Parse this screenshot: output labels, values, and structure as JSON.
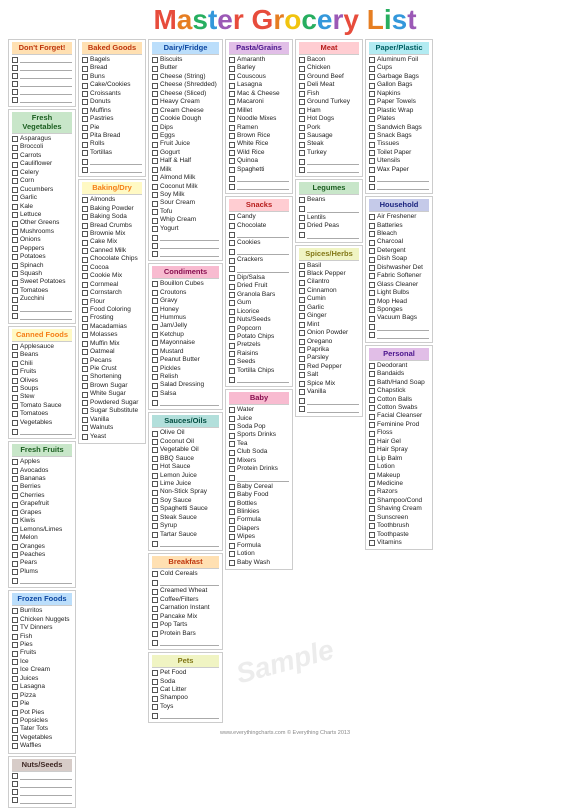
{
  "title": {
    "text": "Master Grocery List",
    "letters": [
      {
        "char": "M",
        "color": "#e74c3c"
      },
      {
        "char": "a",
        "color": "#e67e22"
      },
      {
        "char": "s",
        "color": "#27ae60"
      },
      {
        "char": "t",
        "color": "#3498db"
      },
      {
        "char": "e",
        "color": "#9b59b6"
      },
      {
        "char": "r",
        "color": "#e74c3c"
      },
      {
        "char": " ",
        "color": "#000"
      },
      {
        "char": "G",
        "color": "#e74c3c"
      },
      {
        "char": "r",
        "color": "#e67e22"
      },
      {
        "char": "o",
        "color": "#f1c40f"
      },
      {
        "char": "c",
        "color": "#27ae60"
      },
      {
        "char": "e",
        "color": "#3498db"
      },
      {
        "char": "r",
        "color": "#9b59b6"
      },
      {
        "char": "y",
        "color": "#e74c3c"
      },
      {
        "char": " ",
        "color": "#000"
      },
      {
        "char": "L",
        "color": "#e67e22"
      },
      {
        "char": "i",
        "color": "#27ae60"
      },
      {
        "char": "s",
        "color": "#3498db"
      },
      {
        "char": "t",
        "color": "#9b59b6"
      }
    ]
  },
  "sections": {
    "dont_forget": {
      "label": "Don't Forget!",
      "color": "orange",
      "items": []
    },
    "baked_goods": {
      "label": "Baked Goods",
      "color": "orange",
      "items": [
        "Bagels",
        "Bread",
        "Buns",
        "Cake/Cookies",
        "Croissants",
        "Donuts",
        "Muffins",
        "Pastries",
        "Pie",
        "Pita Bread",
        "Rolls",
        "Tortillas"
      ]
    },
    "fresh_veg": {
      "label": "Fresh Vegetables",
      "color": "green",
      "items": [
        "Asparagus",
        "Broccoli",
        "Carrots",
        "Cauliflower",
        "Celery",
        "Corn",
        "Cucumbers",
        "Garlic",
        "Kale",
        "Lettuce",
        "Other Greens",
        "Mushrooms",
        "Onions",
        "Peppers",
        "Potatoes",
        "Spinach",
        "Squash",
        "Sweet Potatoes",
        "Tomatoes",
        "Zucchini"
      ]
    },
    "canned_foods": {
      "label": "Canned Foods",
      "color": "yellow",
      "items": [
        "Applesauce",
        "Beans",
        "Chili",
        "Fruits",
        "Olives",
        "Soups",
        "Stew",
        "Tomato Sauce",
        "Tomatoes",
        "Vegetables"
      ]
    },
    "fresh_fruits": {
      "label": "Fresh Fruits",
      "color": "green",
      "items": [
        "Apples",
        "Avocados",
        "Bananas",
        "Berries",
        "Cherries",
        "Grapefruit",
        "Grapes",
        "Kiwis",
        "Lemons/Limes",
        "Melon",
        "Oranges",
        "Peaches",
        "Pears",
        "Plums"
      ]
    },
    "frozen_foods": {
      "label": "Frozen Foods",
      "color": "blue",
      "items": [
        "Burritos",
        "Chicken Nuggets",
        "TV Dinners",
        "Fish",
        "Pies",
        "Fruits",
        "Ice",
        "Ice Cream",
        "Juices",
        "Lasagna",
        "Pizza",
        "Pie",
        "Pot Pies",
        "Popsicles",
        "Tater Tots",
        "Vegetables",
        "Waffles"
      ]
    },
    "nuts_seeds": {
      "label": "Nuts/Seeds",
      "color": "brown",
      "items": []
    },
    "dairy_fridge": {
      "label": "Dairy/Fridge",
      "color": "blue",
      "items": [
        "Biscuits",
        "Butter",
        "Cheese (String)",
        "Cheese (Shredded)",
        "Cheese (Sliced)",
        "Heavy Cream",
        "Cream Cheese",
        "Cookie Dough",
        "Dips",
        "Eggs",
        "Fruit Juice",
        "Gogurt",
        "Half & Half",
        "Milk",
        "Almond Milk",
        "Coconut Milk",
        "Soy Milk",
        "Sour Cream",
        "Tofu",
        "Whip Cream",
        "Yogurt"
      ]
    },
    "baking_dry": {
      "label": "Baking/Dry",
      "color": "yellow",
      "items": [
        "Almonds",
        "Baking Powder",
        "Baking Soda",
        "Bread Crumbs",
        "Brownie Mix",
        "Cake Mix",
        "Canned Milk",
        "Chocolate Chips",
        "Cocoa",
        "Cookie Mix",
        "Cornmeal",
        "Cornstarch",
        "Flour",
        "Food Coloring",
        "Frosting",
        "Macadamias",
        "Molasses",
        "Muffin Mix",
        "Oatmeal",
        "Pecans",
        "Pie Crust",
        "Shortening",
        "Brown Sugar",
        "White Sugar",
        "Powdered Sugar",
        "Sugar Substitute",
        "Vanilla",
        "Walnuts",
        "Yeast"
      ]
    },
    "condiments": {
      "label": "Condiments",
      "color": "pink",
      "items": [
        "Bouillon Cubes",
        "Croutons",
        "Gravy",
        "Honey",
        "Hummus",
        "Jam/Jelly",
        "Ketchup",
        "Mayonnaise",
        "Mustard",
        "Peanut Butter",
        "Pickles",
        "Relish",
        "Salad Dressing",
        "Salsa"
      ]
    },
    "sauces_oils": {
      "label": "Sauces/Oils",
      "color": "teal",
      "items": [
        "Olive Oil",
        "Coconut Oil",
        "Vegetable Oil",
        "BBQ Sauce",
        "Hot Sauce",
        "Lemon Juice",
        "Lime Juice",
        "Non-Stick Spray",
        "Soy Sauce",
        "Spaghetti Sauce",
        "Steak Sauce",
        "Syrup",
        "Tartar Sauce"
      ]
    },
    "breakfast": {
      "label": "Breakfast",
      "color": "orange",
      "items": [
        "Cold Cereals",
        "",
        "Creamed Wheat",
        "Coffee/Filters",
        "Carnation Instant",
        "Pancake Mix",
        "Pop Tarts",
        "Protein Bars"
      ]
    },
    "pets": {
      "label": "Pets",
      "color": "lime",
      "items": [
        "Pet Food",
        "Soda",
        "Cat Litter",
        "Shampoo",
        "Toys"
      ]
    },
    "pasta_grains": {
      "label": "Pasta/Grains",
      "color": "purple",
      "items": [
        "Amaranth",
        "Barley",
        "Couscous",
        "Lasagna",
        "Mac & Cheese",
        "Macaroni",
        "Millet",
        "Noodle Mixes",
        "Ramen",
        "Brown Rice",
        "White Rice",
        "Wild Rice",
        "Quinoa",
        "Spaghetti"
      ]
    },
    "snacks": {
      "label": "Snacks",
      "color": "red",
      "items": [
        "Candy",
        "Chocolate",
        "",
        "Cookies",
        "",
        "Crackers",
        "",
        "Dip/Salsa",
        "Dried Fruit",
        "Granola Bars",
        "Gum",
        "Licorice",
        "Nuts/Seeds",
        "Popcorn",
        "Potato Chips",
        "Pretzels",
        "Raisins",
        "Seeds",
        "Tortilla Chips"
      ]
    },
    "spices_herbs": {
      "label": "Spices/Herbs",
      "color": "lime",
      "items": [
        "Basil",
        "Black Pepper",
        "Cilantro",
        "Cinnamon",
        "Cumin",
        "Garlic",
        "Ginger",
        "Mint",
        "Onion Powder",
        "Oregano",
        "Paprika",
        "Parsley",
        "Red Pepper",
        "Salt",
        "Spice Mix",
        "Vanilla"
      ]
    },
    "meat": {
      "label": "Meat",
      "color": "red",
      "items": [
        "Bacon",
        "Chicken",
        "Ground Beef",
        "Deli Meat",
        "Fish",
        "Ground Turkey",
        "Ham",
        "Hot Dogs",
        "Pork",
        "Sausage",
        "Steak",
        "Turkey"
      ]
    },
    "legumes": {
      "label": "Legumes",
      "color": "green",
      "items": [
        "Beans",
        "",
        "Lentils",
        "Dried Peas"
      ]
    },
    "baby": {
      "label": "Baby",
      "color": "pink",
      "items": [
        "Water",
        "Juice",
        "Soda Pop",
        "Sports Drinks",
        "Tea",
        "Club Soda",
        "Mixers",
        "Protein Drinks",
        "",
        "Baby Cereal",
        "Baby Food",
        "Bottles",
        "Blinkies",
        "Formula",
        "Formula",
        "Diapers",
        "Wipes",
        "Formula",
        "Lotion",
        "Baby Wash"
      ]
    },
    "paper_plastic": {
      "label": "Paper/Plastic",
      "color": "cyan",
      "items": [
        "Aluminum Foil",
        "Cups",
        "Garbage Bags",
        "Gallon Bags",
        "Napkins",
        "Paper Towels",
        "Plastic Wrap",
        "Plates",
        "Sandwich Bags",
        "Snack Bags",
        "Tissues",
        "Toilet Paper",
        "Utensils",
        "Wax Paper"
      ]
    },
    "household": {
      "label": "Household",
      "color": "indigo",
      "items": [
        "Air Freshener",
        "Batteries",
        "Bleach",
        "Charcoal",
        "Detergent",
        "Dish Soap",
        "Dishwasher Det",
        "Fabric Softener",
        "Glass Cleaner",
        "Light Bulbs",
        "Mop Head",
        "Sponges",
        "Vacuum Bags"
      ]
    },
    "personal": {
      "label": "Personal",
      "color": "purple",
      "items": [
        "Deodorant",
        "Bandaids",
        "Bath/Hand Soap",
        "Chapstick",
        "Cotton Balls",
        "Cotton Swabs",
        "Facial Cleanser",
        "Feminine Prod",
        "Floss",
        "Hair Gel",
        "Hair Spray",
        "Lip Balm",
        "Lotion",
        "Makeup",
        "Medicine",
        "Razors",
        "Shampoo/Cond",
        "Shaving Cream",
        "Sunscreen",
        "Toothbrush",
        "Toothpaste",
        "Vitamins"
      ]
    }
  },
  "footer": "www.everythingcharts.com   © Everything Charts 2013",
  "watermark": "Sample"
}
